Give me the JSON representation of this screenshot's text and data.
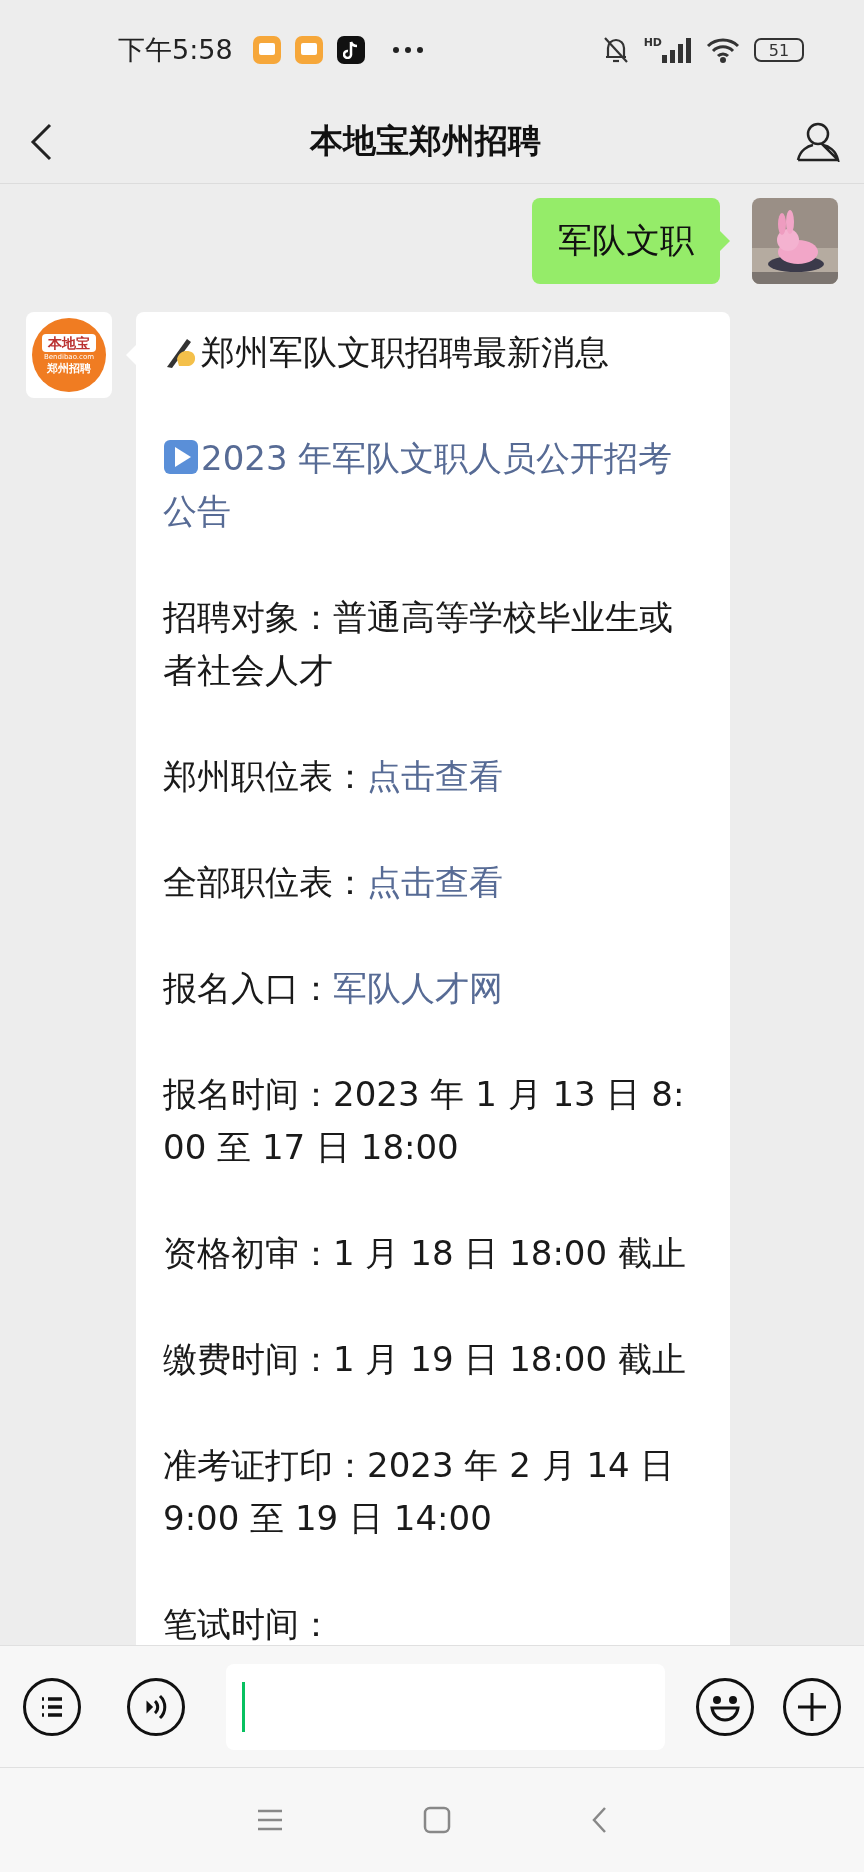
{
  "status_bar": {
    "time": "下午5:58",
    "network": "HD",
    "battery": "51"
  },
  "header": {
    "title": "本地宝郑州招聘"
  },
  "messages": [
    {
      "kind": "sent",
      "text": "军队文职"
    },
    {
      "kind": "received",
      "sender_logo": {
        "top": "本地宝",
        "url": "Bendibao.com",
        "bottom": "郑州招聘"
      },
      "paragraphs": [
        {
          "kind": "title",
          "text": "郑州军队文职招聘最新消息"
        },
        {
          "kind": "announcement",
          "text": "2023 年军队文职人员公开招考公告"
        },
        {
          "kind": "plain",
          "text": "招聘对象：普通高等学校毕业生或者社会人才"
        },
        {
          "kind": "link",
          "label": "郑州职位表：",
          "link": "点击查看"
        },
        {
          "kind": "link",
          "label": "全部职位表：",
          "link": "点击查看"
        },
        {
          "kind": "link",
          "label": "报名入口：",
          "link": "军队人才网"
        },
        {
          "kind": "plain",
          "text": "报名时间：2023 年 1 月 13 日 8:00 至 17 日 18:00"
        },
        {
          "kind": "plain",
          "text": "资格初审：1 月 18 日 18:00 截止"
        },
        {
          "kind": "plain",
          "text": "缴费时间：1 月 19 日 18:00 截止"
        },
        {
          "kind": "plain",
          "text": "准考证打印：2023 年 2 月 14 日 9:00 至 19 日 14:00"
        },
        {
          "kind": "plain",
          "text": "笔试时间："
        }
      ]
    }
  ]
}
